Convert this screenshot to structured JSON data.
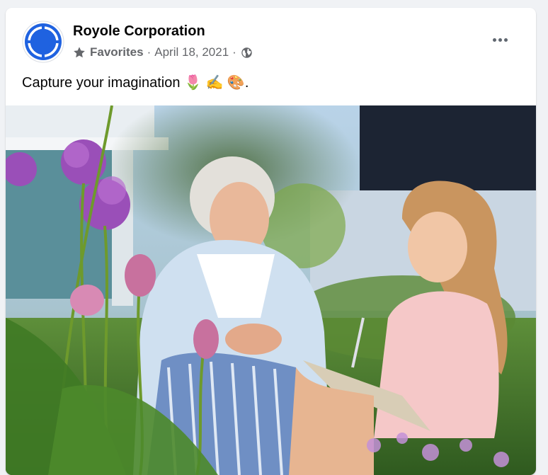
{
  "post": {
    "author": "Royole Corporation",
    "audience_label": "Favorites",
    "separator": "·",
    "date": "April 18, 2021",
    "caption": "Capture your imagination 🌷 ✍️ 🎨."
  },
  "icons": {
    "avatar": "royole-logo",
    "audience": "star-icon",
    "privacy": "globe-icon",
    "more": "more-options-icon"
  },
  "colors": {
    "brand_blue": "#1f62e0",
    "text_primary": "#050505",
    "text_secondary": "#65676b",
    "card_bg": "#ffffff",
    "page_bg": "#f0f2f5"
  }
}
